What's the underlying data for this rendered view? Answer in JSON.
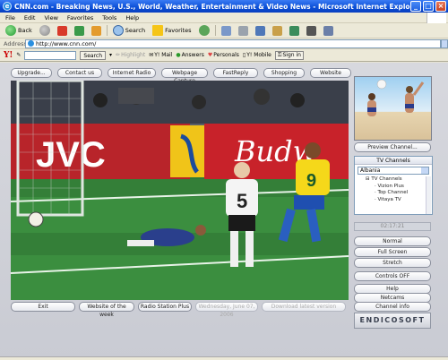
{
  "window": {
    "title": "CNN.com - Breaking News, U.S., World, Weather, Entertainment & Video News - Microsoft Internet Explorer",
    "controls": [
      "minimize",
      "maximize",
      "close"
    ]
  },
  "menu": [
    "File",
    "Edit",
    "View",
    "Favorites",
    "Tools",
    "Help"
  ],
  "toolbar": {
    "back_label": "Back",
    "search_label": "Search",
    "favorites_label": "Favorites"
  },
  "address": {
    "label": "Address",
    "url": "http://www.cnn.com/"
  },
  "yahoo": {
    "logo": "Y!",
    "search_button": "Search",
    "highlight": "Highlight",
    "mail": "Y! Mail",
    "answers": "Answers",
    "personals": "Personals",
    "mobile": "Y! Mobile",
    "signin": "Sign in"
  },
  "app": {
    "top_buttons": [
      "Upgrade...",
      "Contact us",
      "Internet Radio",
      "Webpage Capture",
      "FastReply",
      "Shopping",
      "Website"
    ],
    "bottom_buttons": {
      "exit": "Exit",
      "website_of_week": "Website of the week",
      "radio_station_plus": "Radio Station Plus",
      "date": "Wednesday, June 07, 2006",
      "download": "Download latest version"
    },
    "video_banner": {
      "sponsor_left": "JVC",
      "sponsor_right": "Budw",
      "player_left_number": "5",
      "player_right_number": "9"
    },
    "right_panel": {
      "preview_button": "Preview Channel...",
      "tv_header": "TV Channels",
      "country_select": "Albania",
      "tree_root": "TV Channels",
      "channels": [
        "Vizion Plus",
        "Top Channel",
        "Vitaya TV"
      ],
      "clock": "02:17:21",
      "buttons": [
        "Normal",
        "Full Screen",
        "Stretch",
        "Controls OFF",
        "Help",
        "Netcams",
        "Channel info"
      ],
      "logo": "ENDICOSOFT"
    }
  }
}
